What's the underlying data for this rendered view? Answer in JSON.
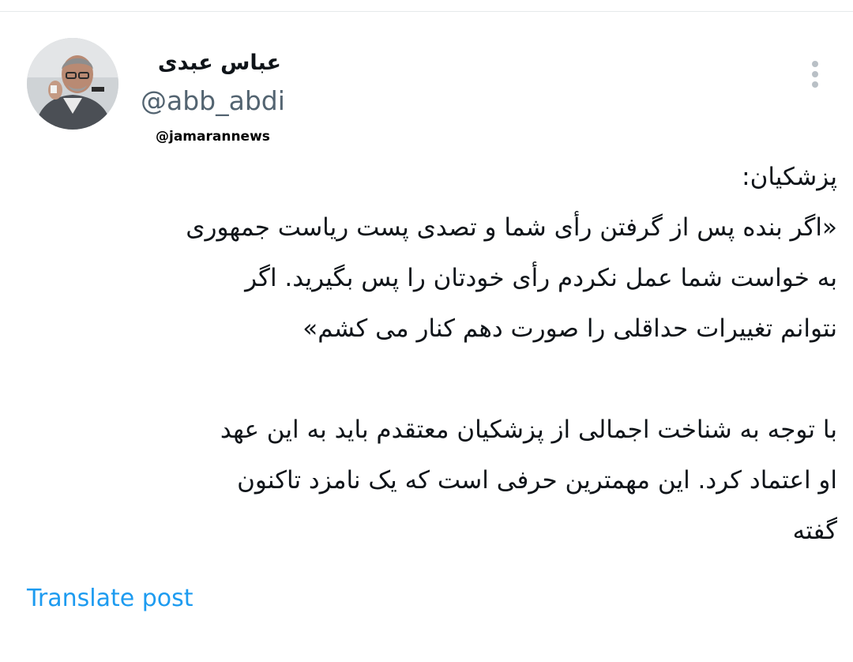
{
  "author": {
    "display_name": "عباس عبدی",
    "handle": "@abb_abdi",
    "avatar_icon": "profile-photo-icon"
  },
  "watermark": "@jamarannews",
  "more_icon": "more-options-icon",
  "tweet": {
    "lines": [
      "پزشکیان:",
      "«اگر بنده پس از گرفتن رأی شما و تصدی پست ریاست جمهوری",
      "به خواست شما عمل نکردم رأی خودتان را پس بگیرید. اگر",
      "نتوانم تغییرات حداقلی را صورت دهم کنار می کشم»",
      "با توجه به شناخت اجمالی از پزشکیان معتقدم باید به این عهد",
      "او اعتماد کرد. این مهمترین حرفی است که یک نامزد تاکنون",
      "گفته"
    ]
  },
  "translate_label": "Translate post",
  "colors": {
    "text": "#0f1419",
    "secondary": "#536471",
    "link": "#1d9bf0"
  }
}
